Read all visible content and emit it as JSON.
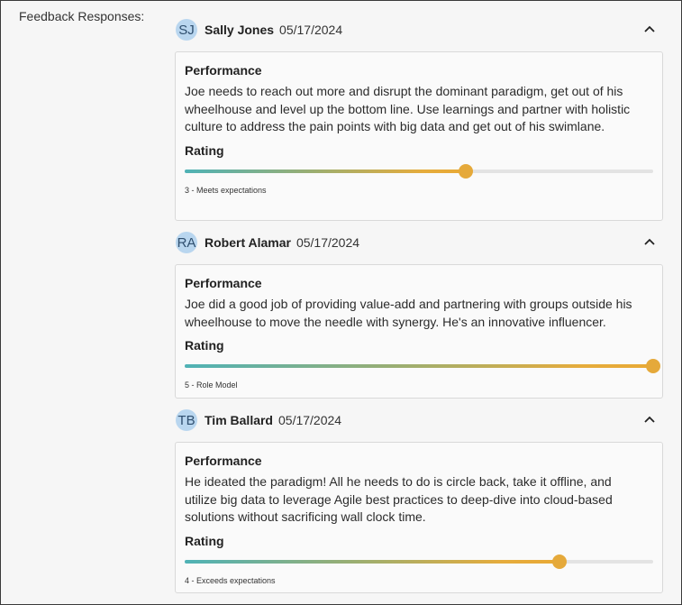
{
  "section_label": "Feedback Responses:",
  "responses": [
    {
      "initials": "SJ",
      "name": "Sally Jones",
      "date": "05/17/2024",
      "category": "Performance",
      "comment": "Joe needs to reach out more and disrupt the dominant paradigm, get out of his wheelhouse and level up the bottom line. Use learnings and partner with holistic culture to address the pain points with big data and get out of his swimlane.",
      "rating_label": "Rating",
      "rating_value": 3,
      "rating_max": 5,
      "rating_fraction": 0.6,
      "rating_text": "3 - Meets expectations"
    },
    {
      "initials": "RA",
      "name": "Robert Alamar",
      "date": "05/17/2024",
      "category": "Performance",
      "comment": "Joe did a good job of providing value-add and partnering with groups outside his wheelhouse to move the needle with synergy. He's an innovative influencer.",
      "rating_label": "Rating",
      "rating_value": 5,
      "rating_max": 5,
      "rating_fraction": 1.0,
      "rating_text": "5 - Role Model"
    },
    {
      "initials": "TB",
      "name": "Tim Ballard",
      "date": "05/17/2024",
      "category": "Performance",
      "comment": "He ideated the paradigm! All he needs to do is circle back, take it offline, and utilize big data to leverage Agile best practices to deep-dive into cloud-based solutions without sacrificing wall clock time.",
      "rating_label": "Rating",
      "rating_value": 4,
      "rating_max": 5,
      "rating_fraction": 0.8,
      "rating_text": "4 - Exceeds expectations"
    }
  ],
  "icons": {
    "collapse": "chevron-up-icon"
  },
  "colors": {
    "avatar_bg": "#b9d6ef",
    "slider_start": "#4fb2b6",
    "slider_end": "#e8a935",
    "thumb": "#e5a93a",
    "track": "#e3e3e3"
  }
}
